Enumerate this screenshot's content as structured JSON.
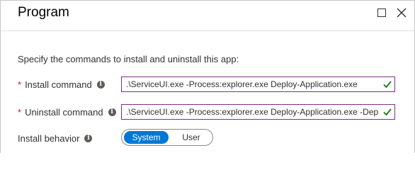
{
  "panel": {
    "title": "Program"
  },
  "intro": "Specify the commands to install and uninstall this app:",
  "fields": {
    "install": {
      "label": "Install command",
      "required_marker": "*",
      "value": ".\\ServiceUI.exe -Process:explorer.exe Deploy-Application.exe"
    },
    "uninstall": {
      "label": "Uninstall command",
      "required_marker": "*",
      "value": ".\\ServiceUI.exe -Process:explorer.exe Deploy-Application.exe -DeploymentType Uninstall"
    }
  },
  "install_behavior": {
    "label": "Install behavior",
    "options": [
      "System",
      "User"
    ],
    "selected": "System"
  },
  "colors": {
    "accent": "#0078d4",
    "field_border": "#7f2f83",
    "valid_check": "#107c10",
    "required": "#a4262c"
  },
  "icons": {
    "maximize": "maximize-icon",
    "close": "close-icon",
    "info": "info-icon",
    "valid": "checkmark-icon"
  }
}
